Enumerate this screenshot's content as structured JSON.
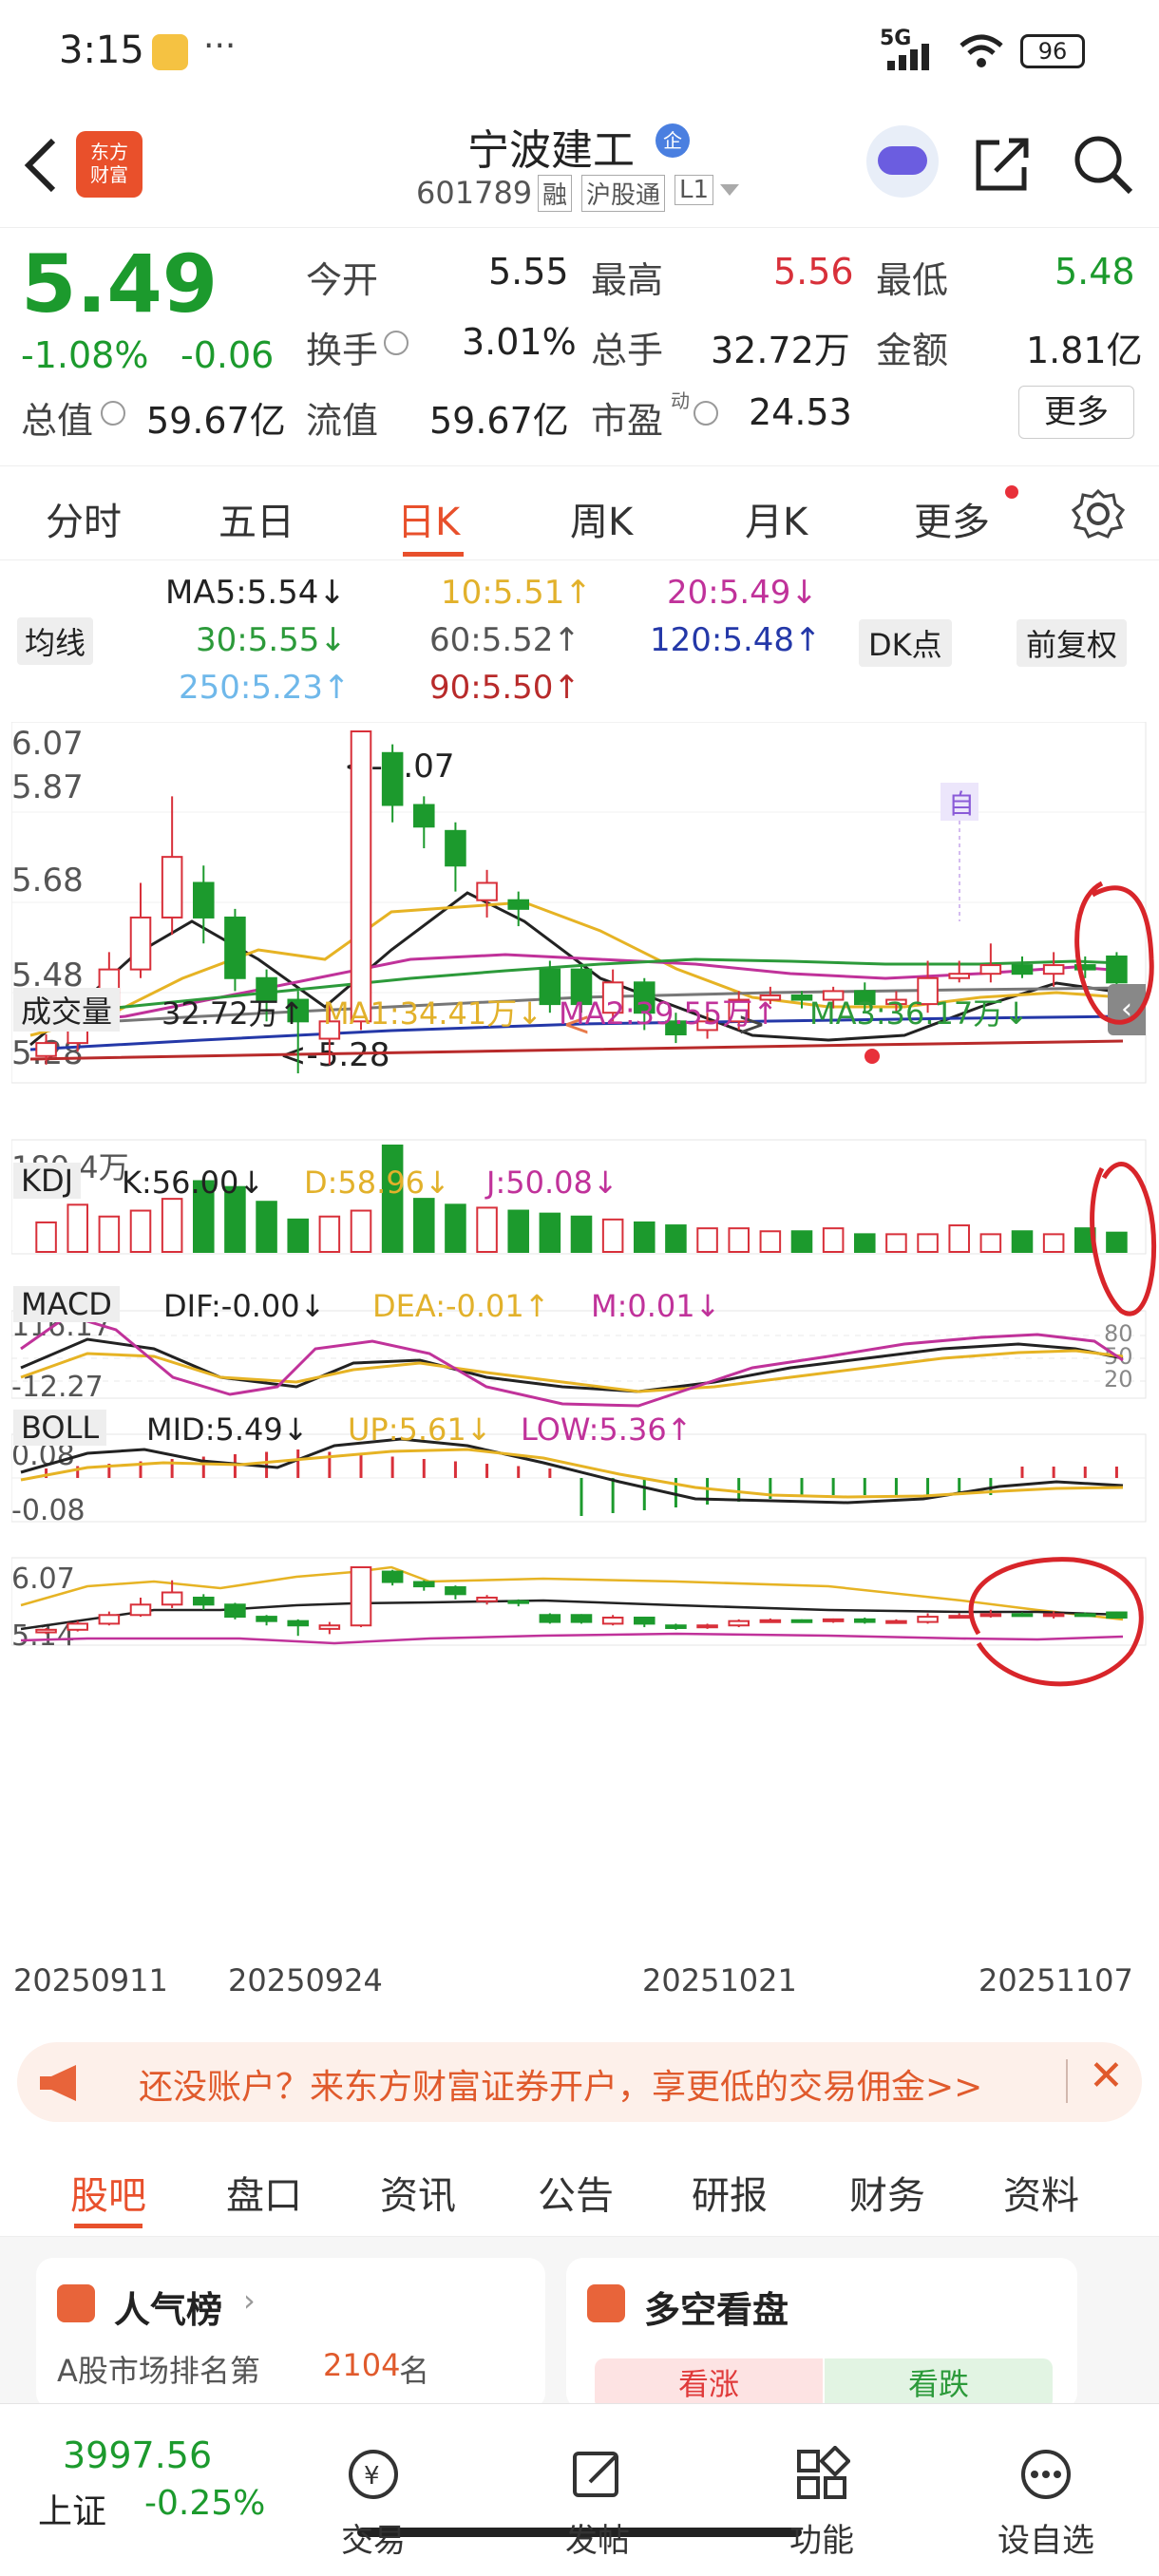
{
  "status": {
    "time": "3:15",
    "dots": "···",
    "network": "5G",
    "battery": "96"
  },
  "header": {
    "logo_text": "东方\n财富",
    "stock_name": "宁波建工",
    "stock_badge": "企",
    "code": "601789",
    "tags": [
      "融",
      "沪股通",
      "L1"
    ]
  },
  "quote": {
    "price": "5.49",
    "change_pct": "-1.08%",
    "change_amt": "-0.06",
    "fields": [
      {
        "label": "今开",
        "value": "5.55"
      },
      {
        "label": "最高",
        "value": "5.56"
      },
      {
        "label": "最低",
        "value": "5.48"
      },
      {
        "label": "换手",
        "value": "3.01%"
      },
      {
        "label": "总手",
        "value": "32.72万"
      },
      {
        "label": "金额",
        "value": "1.81亿"
      },
      {
        "label": "总值",
        "value": "59.67亿"
      },
      {
        "label": "流值",
        "value": "59.67亿"
      },
      {
        "label": "市盈",
        "value": "24.53"
      }
    ],
    "pe_sup": "动",
    "more": "更多"
  },
  "tabs": [
    "分时",
    "五日",
    "日K",
    "周K",
    "月K",
    "更多"
  ],
  "ma": {
    "selector": "均线",
    "ma5": "MA5:5.54↓",
    "ma10": "10:5.51↑",
    "ma20": "20:5.49↓",
    "ma30": "30:5.55↓",
    "ma60": "60:5.52↑",
    "ma120": "120:5.48↑",
    "ma250": "250:5.23↑",
    "ma90": "90:5.50↑",
    "dk": "DK点",
    "fq": "前复权"
  },
  "kchart": {
    "y_labels": [
      "6.07",
      "5.87",
      "5.68",
      "5.48",
      "5.28"
    ],
    "high_mark": "<-6.07",
    "low_mark": "<-5.28",
    "zi": "自"
  },
  "volume": {
    "selector": "成交量",
    "val": "32.72万↑",
    "ma1": "MA1:34.41万↓",
    "ma2": "MA2:39.55万↑",
    "ma3": "MA3:36.17万↓",
    "max": "180.4万"
  },
  "kdj": {
    "selector": "KDJ",
    "k": "K:56.00↓",
    "d": "D:58.96↓",
    "j": "J:50.08↓",
    "top": "116.17",
    "bottom": "-12.27",
    "levels": [
      "80",
      "50",
      "20"
    ]
  },
  "macd": {
    "selector": "MACD",
    "dif": "DIF:-0.00↓",
    "dea": "DEA:-0.01↑",
    "m": "M:0.01↓",
    "top": "0.08",
    "bottom": "-0.08"
  },
  "boll": {
    "selector": "BOLL",
    "mid": "MID:5.49↓",
    "up": "UP:5.61↓",
    "low": "LOW:5.36↑",
    "top": "6.07",
    "bottom": "5.14"
  },
  "dates": [
    "20250911",
    "20250924",
    "20251021",
    "20251107"
  ],
  "chart_data": {
    "type": "candlestick",
    "title": "宁波建工 日K",
    "ylim": [
      5.28,
      6.07
    ],
    "candles": [
      [
        5.32,
        5.35,
        5.3,
        5.37
      ],
      [
        5.35,
        5.42,
        5.33,
        5.45
      ],
      [
        5.42,
        5.52,
        5.4,
        5.56
      ],
      [
        5.52,
        5.64,
        5.5,
        5.72
      ],
      [
        5.64,
        5.78,
        5.6,
        5.92
      ],
      [
        5.72,
        5.64,
        5.58,
        5.76
      ],
      [
        5.64,
        5.5,
        5.47,
        5.66
      ],
      [
        5.5,
        5.45,
        5.4,
        5.52
      ],
      [
        5.45,
        5.4,
        5.28,
        5.47
      ],
      [
        5.36,
        5.4,
        5.3,
        5.44
      ],
      [
        5.4,
        6.07,
        5.38,
        6.07
      ],
      [
        6.02,
        5.9,
        5.86,
        6.04
      ],
      [
        5.9,
        5.85,
        5.8,
        5.92
      ],
      [
        5.84,
        5.76,
        5.7,
        5.86
      ],
      [
        5.68,
        5.72,
        5.64,
        5.75
      ],
      [
        5.68,
        5.66,
        5.62,
        5.7
      ],
      [
        5.52,
        5.44,
        5.42,
        5.54
      ],
      [
        5.52,
        5.44,
        5.42,
        5.53
      ],
      [
        5.42,
        5.49,
        5.4,
        5.52
      ],
      [
        5.49,
        5.42,
        5.38,
        5.5
      ],
      [
        5.4,
        5.37,
        5.35,
        5.42
      ],
      [
        5.38,
        5.4,
        5.36,
        5.42
      ],
      [
        5.4,
        5.45,
        5.38,
        5.47
      ],
      [
        5.45,
        5.46,
        5.44,
        5.48
      ],
      [
        5.46,
        5.45,
        5.43,
        5.47
      ],
      [
        5.45,
        5.47,
        5.43,
        5.48
      ],
      [
        5.47,
        5.44,
        5.42,
        5.49
      ],
      [
        5.44,
        5.45,
        5.42,
        5.47
      ],
      [
        5.44,
        5.5,
        5.42,
        5.54
      ],
      [
        5.5,
        5.51,
        5.49,
        5.54
      ],
      [
        5.51,
        5.53,
        5.49,
        5.58
      ],
      [
        5.53,
        5.51,
        5.5,
        5.55
      ],
      [
        5.51,
        5.53,
        5.48,
        5.56
      ],
      [
        5.53,
        5.52,
        5.5,
        5.55
      ],
      [
        5.55,
        5.49,
        5.48,
        5.56
      ]
    ],
    "volume": [
      50,
      80,
      60,
      70,
      90,
      120,
      110,
      85,
      55,
      60,
      70,
      180.4,
      90,
      80,
      75,
      70,
      65,
      60,
      55,
      50,
      45,
      40,
      40,
      35,
      35,
      40,
      30,
      30,
      30,
      45,
      30,
      35,
      30,
      40,
      32.72
    ]
  },
  "banner": {
    "text": "还没账户？来东方财富证券开户，享更低的交易佣金>>"
  },
  "content_tabs": [
    "股吧",
    "盘口",
    "资讯",
    "公告",
    "研报",
    "财务",
    "资料"
  ],
  "cards": {
    "left_title": "人气榜",
    "left_sub_prefix": "A股市场排名第",
    "left_rank": "2104",
    "left_sub_suffix": "名",
    "right_title": "多空看盘",
    "bull": "看涨",
    "bear": "看跌"
  },
  "bottom": {
    "index_val": "3997.56",
    "index_name": "上证",
    "index_chg": "-0.25%",
    "nav": [
      "交易",
      "发帖",
      "功能",
      "设自选"
    ]
  }
}
